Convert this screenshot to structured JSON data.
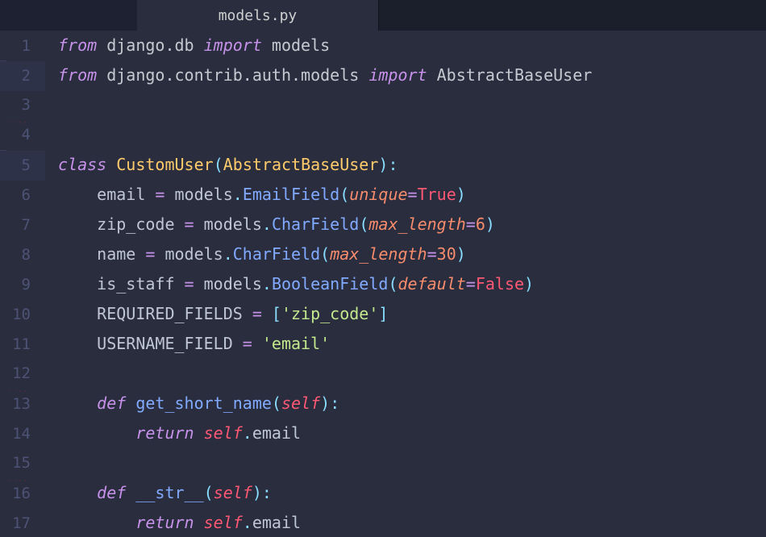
{
  "tab": {
    "filename": "models.py"
  },
  "lines": [
    {
      "n": "1",
      "hl": false,
      "bar": false,
      "ws": false,
      "tokens": [
        [
          "kw",
          "from"
        ],
        [
          "ns",
          " django.db "
        ],
        [
          "kw",
          "import"
        ],
        [
          "ns",
          " models"
        ]
      ]
    },
    {
      "n": "2",
      "hl": true,
      "bar": true,
      "ws": false,
      "tokens": [
        [
          "kw",
          "from"
        ],
        [
          "ns",
          " django.contrib.auth.models "
        ],
        [
          "kw",
          "import"
        ],
        [
          "ns",
          " AbstractBaseUser"
        ]
      ]
    },
    {
      "n": "3",
      "hl": false,
      "bar": false,
      "ws": true,
      "tokens": []
    },
    {
      "n": "4",
      "hl": false,
      "bar": false,
      "ws": false,
      "tokens": []
    },
    {
      "n": "5",
      "hl": true,
      "bar": true,
      "ws": false,
      "tokens": [
        [
          "kw",
          "class"
        ],
        [
          "ident",
          " "
        ],
        [
          "cls",
          "CustomUser"
        ],
        [
          "punc",
          "("
        ],
        [
          "type",
          "AbstractBaseUser"
        ],
        [
          "punc",
          ")"
        ],
        [
          "punc",
          ":"
        ]
      ]
    },
    {
      "n": "6",
      "hl": false,
      "bar": false,
      "ws": false,
      "tokens": [
        [
          "ident",
          "    email "
        ],
        [
          "op",
          "="
        ],
        [
          "ident",
          " models"
        ],
        [
          "punc",
          "."
        ],
        [
          "fn",
          "EmailField"
        ],
        [
          "punc",
          "("
        ],
        [
          "arg",
          "unique"
        ],
        [
          "op",
          "="
        ],
        [
          "bool",
          "True"
        ],
        [
          "punc",
          ")"
        ]
      ]
    },
    {
      "n": "7",
      "hl": false,
      "bar": false,
      "ws": false,
      "tokens": [
        [
          "ident",
          "    zip_code "
        ],
        [
          "op",
          "="
        ],
        [
          "ident",
          " models"
        ],
        [
          "punc",
          "."
        ],
        [
          "fn",
          "CharField"
        ],
        [
          "punc",
          "("
        ],
        [
          "arg",
          "max_length"
        ],
        [
          "op",
          "="
        ],
        [
          "num",
          "6"
        ],
        [
          "punc",
          ")"
        ]
      ]
    },
    {
      "n": "8",
      "hl": false,
      "bar": false,
      "ws": false,
      "tokens": [
        [
          "ident",
          "    name "
        ],
        [
          "op",
          "="
        ],
        [
          "ident",
          " models"
        ],
        [
          "punc",
          "."
        ],
        [
          "fn",
          "CharField"
        ],
        [
          "punc",
          "("
        ],
        [
          "arg",
          "max_length"
        ],
        [
          "op",
          "="
        ],
        [
          "num",
          "30"
        ],
        [
          "punc",
          ")"
        ]
      ]
    },
    {
      "n": "9",
      "hl": false,
      "bar": false,
      "ws": false,
      "tokens": [
        [
          "ident",
          "    is_staff "
        ],
        [
          "op",
          "="
        ],
        [
          "ident",
          " models"
        ],
        [
          "punc",
          "."
        ],
        [
          "fn",
          "BooleanField"
        ],
        [
          "punc",
          "("
        ],
        [
          "arg",
          "default"
        ],
        [
          "op",
          "="
        ],
        [
          "bool",
          "False"
        ],
        [
          "punc",
          ")"
        ]
      ]
    },
    {
      "n": "10",
      "hl": false,
      "bar": false,
      "ws": false,
      "tokens": [
        [
          "ident",
          "    REQUIRED_FIELDS "
        ],
        [
          "op",
          "="
        ],
        [
          "ident",
          " "
        ],
        [
          "punc",
          "["
        ],
        [
          "str",
          "'zip_code'"
        ],
        [
          "punc",
          "]"
        ]
      ]
    },
    {
      "n": "11",
      "hl": false,
      "bar": false,
      "ws": false,
      "tokens": [
        [
          "ident",
          "    USERNAME_FIELD "
        ],
        [
          "op",
          "="
        ],
        [
          "ident",
          " "
        ],
        [
          "str",
          "'email'"
        ]
      ]
    },
    {
      "n": "12",
      "hl": false,
      "bar": false,
      "ws": true,
      "tokens": []
    },
    {
      "n": "13",
      "hl": false,
      "bar": false,
      "ws": false,
      "tokens": [
        [
          "ident",
          "    "
        ],
        [
          "kw",
          "def"
        ],
        [
          "ident",
          " "
        ],
        [
          "fn",
          "get_short_name"
        ],
        [
          "punc",
          "("
        ],
        [
          "selfk",
          "self"
        ],
        [
          "punc",
          ")"
        ],
        [
          "punc",
          ":"
        ]
      ]
    },
    {
      "n": "14",
      "hl": false,
      "bar": false,
      "ws": false,
      "tokens": [
        [
          "ident",
          "        "
        ],
        [
          "kw",
          "return"
        ],
        [
          "ident",
          " "
        ],
        [
          "selfk",
          "self"
        ],
        [
          "punc",
          "."
        ],
        [
          "ident",
          "email"
        ]
      ]
    },
    {
      "n": "15",
      "hl": false,
      "bar": false,
      "ws": true,
      "tokens": []
    },
    {
      "n": "16",
      "hl": false,
      "bar": false,
      "ws": false,
      "tokens": [
        [
          "ident",
          "    "
        ],
        [
          "kw",
          "def"
        ],
        [
          "ident",
          " "
        ],
        [
          "fn",
          "__str__"
        ],
        [
          "punc",
          "("
        ],
        [
          "selfk",
          "self"
        ],
        [
          "punc",
          ")"
        ],
        [
          "punc",
          ":"
        ]
      ]
    },
    {
      "n": "17",
      "hl": false,
      "bar": false,
      "ws": false,
      "tokens": [
        [
          "ident",
          "        "
        ],
        [
          "kw",
          "return"
        ],
        [
          "ident",
          " "
        ],
        [
          "selfk",
          "self"
        ],
        [
          "punc",
          "."
        ],
        [
          "ident",
          "email"
        ]
      ]
    }
  ]
}
